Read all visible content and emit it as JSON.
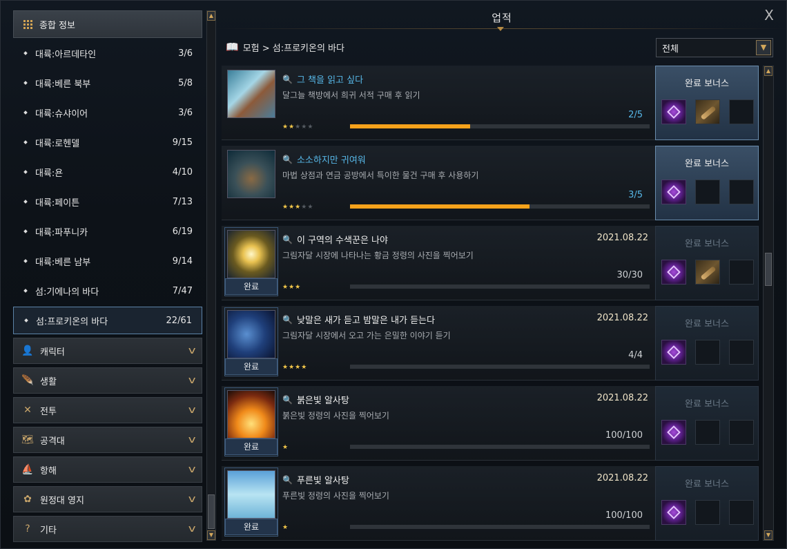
{
  "window": {
    "title": "업적",
    "close_label": "X"
  },
  "sidebar": {
    "header": {
      "label": "종합 정보"
    },
    "items": [
      {
        "label": "대륙:아르데타인",
        "count": "3/6"
      },
      {
        "label": "대륙:베른 북부",
        "count": "5/8"
      },
      {
        "label": "대륙:슈샤이어",
        "count": "3/6"
      },
      {
        "label": "대륙:로헨델",
        "count": "9/15"
      },
      {
        "label": "대륙:욘",
        "count": "4/10"
      },
      {
        "label": "대륙:페이튼",
        "count": "7/13"
      },
      {
        "label": "대륙:파푸니카",
        "count": "6/19"
      },
      {
        "label": "대륙:베른 남부",
        "count": "9/14"
      },
      {
        "label": "섬:기에나의 바다",
        "count": "7/47"
      },
      {
        "label": "섬:프로키온의 바다",
        "count": "22/61"
      }
    ],
    "selected_index": 9,
    "categories": [
      {
        "label": "캐릭터",
        "icon": "person-icon"
      },
      {
        "label": "생활",
        "icon": "feather-icon"
      },
      {
        "label": "전투",
        "icon": "crossed-swords-icon"
      },
      {
        "label": "공격대",
        "icon": "raid-map-icon"
      },
      {
        "label": "항해",
        "icon": "ship-icon"
      },
      {
        "label": "원정대 영지",
        "icon": "estate-lotus-icon"
      },
      {
        "label": "기타",
        "icon": "question-icon"
      }
    ]
  },
  "breadcrumb": {
    "text": "모험 > 섬:프로키온의 바다"
  },
  "filter": {
    "selected": "전체"
  },
  "achievements": [
    {
      "title": "그 책을 읽고 싶다",
      "desc": "달그늘 책방에서 희귀 서적 구매 후 읽기",
      "progress": "2/5",
      "date": "",
      "stars": 2,
      "fill": 0.4,
      "completed": false,
      "active": true
    },
    {
      "title": "소소하지만 귀여워",
      "desc": "마법 상점과 연금 공방에서 특이한 물건 구매 후 사용하기",
      "progress": "3/5",
      "date": "",
      "stars": 3,
      "fill": 0.6,
      "completed": false,
      "active": true
    },
    {
      "title": "이 구역의 수색꾼은 나야",
      "desc": "그림자달 시장에 나타나는 황금 정령의 사진을 찍어보기",
      "progress": "30/30",
      "date": "2021.08.22",
      "stars": 3,
      "fill": 0,
      "completed": true,
      "active": false
    },
    {
      "title": "낮말은 새가 듣고 밤말은 내가 듣는다",
      "desc": "그림자달 시장에서 오고 가는 은밀한 이야기 듣기",
      "progress": "4/4",
      "date": "2021.08.22",
      "stars": 4,
      "fill": 0,
      "completed": true,
      "active": false
    },
    {
      "title": "붉은빛 알사탕",
      "desc": "붉은빛 정령의 사진을 찍어보기",
      "progress": "100/100",
      "date": "2021.08.22",
      "stars": 1,
      "fill": 0,
      "completed": true,
      "active": false
    },
    {
      "title": "푸른빛 알사탕",
      "desc": "푸른빛 정령의 사진을 찍어보기",
      "progress": "100/100",
      "date": "2021.08.22",
      "stars": 1,
      "fill": 0,
      "completed": true,
      "active": false
    }
  ],
  "completed_label": "완료",
  "bonus_label": "완료 보너스",
  "bonuses": [
    {
      "slots": [
        "gem",
        "scroll",
        "empty"
      ]
    },
    {
      "slots": [
        "gem",
        "empty",
        "empty"
      ]
    },
    {
      "slots": [
        "gem",
        "scroll",
        "empty"
      ]
    },
    {
      "slots": [
        "gem",
        "empty",
        "empty"
      ]
    },
    {
      "slots": [
        "gem",
        "empty",
        "empty"
      ]
    },
    {
      "slots": [
        "gem",
        "empty",
        "empty"
      ]
    }
  ]
}
